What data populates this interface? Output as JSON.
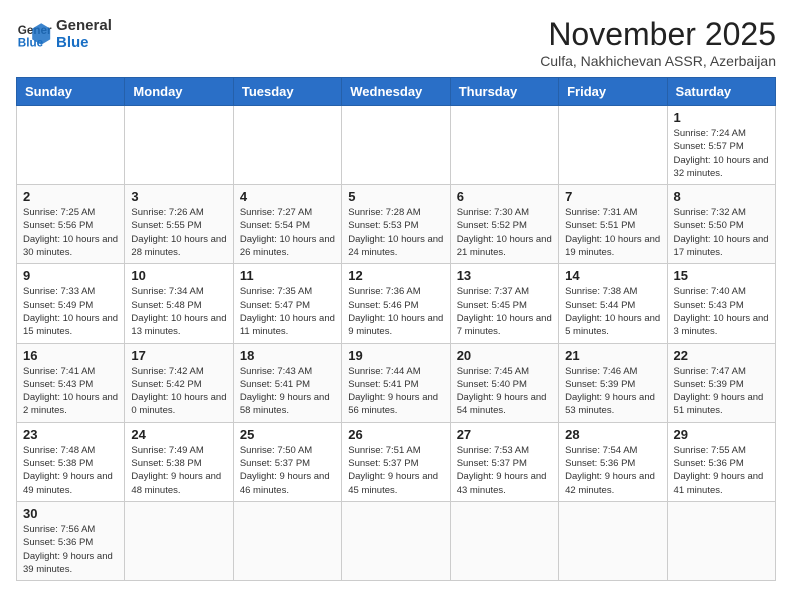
{
  "logo": {
    "text_general": "General",
    "text_blue": "Blue"
  },
  "header": {
    "month": "November 2025",
    "location": "Culfa, Nakhichevan ASSR, Azerbaijan"
  },
  "weekdays": [
    "Sunday",
    "Monday",
    "Tuesday",
    "Wednesday",
    "Thursday",
    "Friday",
    "Saturday"
  ],
  "weeks": [
    [
      {
        "day": "",
        "info": ""
      },
      {
        "day": "",
        "info": ""
      },
      {
        "day": "",
        "info": ""
      },
      {
        "day": "",
        "info": ""
      },
      {
        "day": "",
        "info": ""
      },
      {
        "day": "",
        "info": ""
      },
      {
        "day": "1",
        "info": "Sunrise: 7:24 AM\nSunset: 5:57 PM\nDaylight: 10 hours and 32 minutes."
      }
    ],
    [
      {
        "day": "2",
        "info": "Sunrise: 7:25 AM\nSunset: 5:56 PM\nDaylight: 10 hours and 30 minutes."
      },
      {
        "day": "3",
        "info": "Sunrise: 7:26 AM\nSunset: 5:55 PM\nDaylight: 10 hours and 28 minutes."
      },
      {
        "day": "4",
        "info": "Sunrise: 7:27 AM\nSunset: 5:54 PM\nDaylight: 10 hours and 26 minutes."
      },
      {
        "day": "5",
        "info": "Sunrise: 7:28 AM\nSunset: 5:53 PM\nDaylight: 10 hours and 24 minutes."
      },
      {
        "day": "6",
        "info": "Sunrise: 7:30 AM\nSunset: 5:52 PM\nDaylight: 10 hours and 21 minutes."
      },
      {
        "day": "7",
        "info": "Sunrise: 7:31 AM\nSunset: 5:51 PM\nDaylight: 10 hours and 19 minutes."
      },
      {
        "day": "8",
        "info": "Sunrise: 7:32 AM\nSunset: 5:50 PM\nDaylight: 10 hours and 17 minutes."
      }
    ],
    [
      {
        "day": "9",
        "info": "Sunrise: 7:33 AM\nSunset: 5:49 PM\nDaylight: 10 hours and 15 minutes."
      },
      {
        "day": "10",
        "info": "Sunrise: 7:34 AM\nSunset: 5:48 PM\nDaylight: 10 hours and 13 minutes."
      },
      {
        "day": "11",
        "info": "Sunrise: 7:35 AM\nSunset: 5:47 PM\nDaylight: 10 hours and 11 minutes."
      },
      {
        "day": "12",
        "info": "Sunrise: 7:36 AM\nSunset: 5:46 PM\nDaylight: 10 hours and 9 minutes."
      },
      {
        "day": "13",
        "info": "Sunrise: 7:37 AM\nSunset: 5:45 PM\nDaylight: 10 hours and 7 minutes."
      },
      {
        "day": "14",
        "info": "Sunrise: 7:38 AM\nSunset: 5:44 PM\nDaylight: 10 hours and 5 minutes."
      },
      {
        "day": "15",
        "info": "Sunrise: 7:40 AM\nSunset: 5:43 PM\nDaylight: 10 hours and 3 minutes."
      }
    ],
    [
      {
        "day": "16",
        "info": "Sunrise: 7:41 AM\nSunset: 5:43 PM\nDaylight: 10 hours and 2 minutes."
      },
      {
        "day": "17",
        "info": "Sunrise: 7:42 AM\nSunset: 5:42 PM\nDaylight: 10 hours and 0 minutes."
      },
      {
        "day": "18",
        "info": "Sunrise: 7:43 AM\nSunset: 5:41 PM\nDaylight: 9 hours and 58 minutes."
      },
      {
        "day": "19",
        "info": "Sunrise: 7:44 AM\nSunset: 5:41 PM\nDaylight: 9 hours and 56 minutes."
      },
      {
        "day": "20",
        "info": "Sunrise: 7:45 AM\nSunset: 5:40 PM\nDaylight: 9 hours and 54 minutes."
      },
      {
        "day": "21",
        "info": "Sunrise: 7:46 AM\nSunset: 5:39 PM\nDaylight: 9 hours and 53 minutes."
      },
      {
        "day": "22",
        "info": "Sunrise: 7:47 AM\nSunset: 5:39 PM\nDaylight: 9 hours and 51 minutes."
      }
    ],
    [
      {
        "day": "23",
        "info": "Sunrise: 7:48 AM\nSunset: 5:38 PM\nDaylight: 9 hours and 49 minutes."
      },
      {
        "day": "24",
        "info": "Sunrise: 7:49 AM\nSunset: 5:38 PM\nDaylight: 9 hours and 48 minutes."
      },
      {
        "day": "25",
        "info": "Sunrise: 7:50 AM\nSunset: 5:37 PM\nDaylight: 9 hours and 46 minutes."
      },
      {
        "day": "26",
        "info": "Sunrise: 7:51 AM\nSunset: 5:37 PM\nDaylight: 9 hours and 45 minutes."
      },
      {
        "day": "27",
        "info": "Sunrise: 7:53 AM\nSunset: 5:37 PM\nDaylight: 9 hours and 43 minutes."
      },
      {
        "day": "28",
        "info": "Sunrise: 7:54 AM\nSunset: 5:36 PM\nDaylight: 9 hours and 42 minutes."
      },
      {
        "day": "29",
        "info": "Sunrise: 7:55 AM\nSunset: 5:36 PM\nDaylight: 9 hours and 41 minutes."
      }
    ],
    [
      {
        "day": "30",
        "info": "Sunrise: 7:56 AM\nSunset: 5:36 PM\nDaylight: 9 hours and 39 minutes."
      },
      {
        "day": "",
        "info": ""
      },
      {
        "day": "",
        "info": ""
      },
      {
        "day": "",
        "info": ""
      },
      {
        "day": "",
        "info": ""
      },
      {
        "day": "",
        "info": ""
      },
      {
        "day": "",
        "info": ""
      }
    ]
  ]
}
